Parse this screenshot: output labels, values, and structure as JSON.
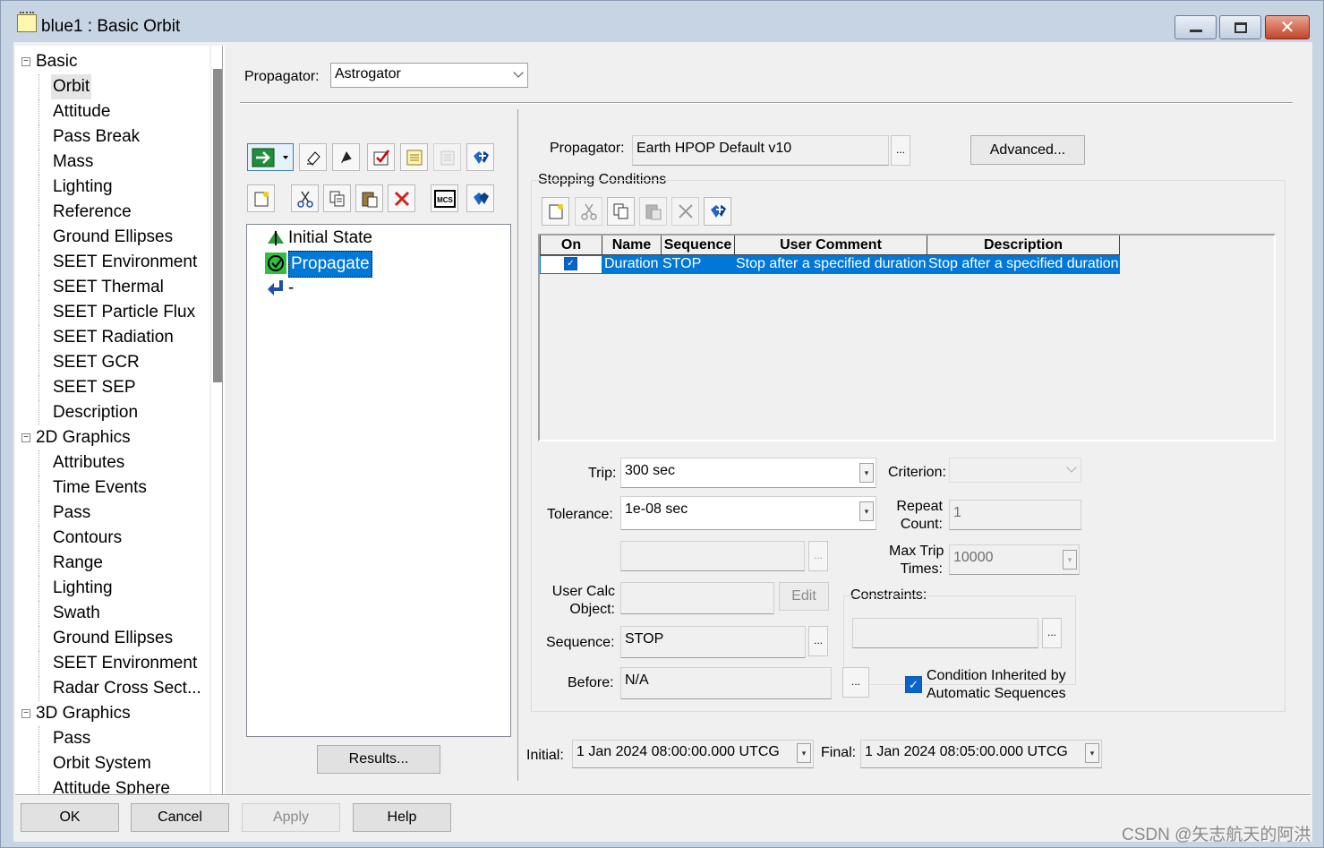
{
  "window": {
    "title": "blue1 : Basic Orbit",
    "min_icon": "minimize-icon",
    "max_icon": "maximize-icon",
    "close_icon": "close-icon"
  },
  "tree": {
    "nodes": [
      {
        "label": "Basic",
        "level": 0,
        "expander": "⊟"
      },
      {
        "label": "Orbit",
        "level": 1,
        "selected": true
      },
      {
        "label": "Attitude",
        "level": 1
      },
      {
        "label": "Pass Break",
        "level": 1
      },
      {
        "label": "Mass",
        "level": 1
      },
      {
        "label": "Lighting",
        "level": 1
      },
      {
        "label": "Reference",
        "level": 1
      },
      {
        "label": "Ground Ellipses",
        "level": 1
      },
      {
        "label": "SEET Environment",
        "level": 1
      },
      {
        "label": "SEET Thermal",
        "level": 1
      },
      {
        "label": "SEET Particle Flux",
        "level": 1
      },
      {
        "label": "SEET Radiation",
        "level": 1
      },
      {
        "label": "SEET GCR",
        "level": 1
      },
      {
        "label": "SEET SEP",
        "level": 1
      },
      {
        "label": "Description",
        "level": 1
      },
      {
        "label": "2D Graphics",
        "level": 0,
        "expander": "⊟"
      },
      {
        "label": "Attributes",
        "level": 1
      },
      {
        "label": "Time Events",
        "level": 1
      },
      {
        "label": "Pass",
        "level": 1
      },
      {
        "label": "Contours",
        "level": 1
      },
      {
        "label": "Range",
        "level": 1
      },
      {
        "label": "Lighting",
        "level": 1
      },
      {
        "label": "Swath",
        "level": 1
      },
      {
        "label": "Ground Ellipses",
        "level": 1
      },
      {
        "label": "SEET Environment",
        "level": 1
      },
      {
        "label": "Radar Cross Sect...",
        "level": 1
      },
      {
        "label": "3D Graphics",
        "level": 0,
        "expander": "⊟"
      },
      {
        "label": "Pass",
        "level": 1
      },
      {
        "label": "Orbit System",
        "level": 1
      },
      {
        "label": "Attitude Sphere",
        "level": 1
      }
    ]
  },
  "propagator_top": {
    "label": "Propagator:",
    "value": "Astrogator"
  },
  "mcs": {
    "items": [
      {
        "label": "Initial State",
        "icon": "initial-state-icon"
      },
      {
        "label": "Propagate",
        "icon": "propagate-icon",
        "selected": true
      },
      {
        "label": "-",
        "icon": "return-arrow-icon"
      }
    ],
    "results_button": "Results...",
    "toolbar_icons": [
      "run-icon",
      "dropdown-arrow-icon",
      "clear-icon",
      "target-icon",
      "checkbox-icon",
      "summary-icon",
      "notes-icon",
      "insert-segment-icon",
      "new-segment-icon",
      "cut-icon",
      "copy-icon",
      "paste-icon",
      "delete-icon",
      "mcs-icon",
      "options-icon"
    ],
    "mcs_text": "MCS"
  },
  "segment": {
    "propagator_label": "Propagator:",
    "propagator_value": "Earth HPOP Default v10",
    "ellipsis": "...",
    "advanced_button": "Advanced...",
    "stopping_conditions_label": "Stopping Conditions",
    "sc_toolbar_icons": [
      "new-icon",
      "cut-icon",
      "copy-icon",
      "paste-icon",
      "delete-icon",
      "insert-icon"
    ]
  },
  "grid": {
    "columns": [
      "On",
      "Name",
      "Sequence",
      "User Comment",
      "Description"
    ],
    "rows": [
      {
        "on": "✓",
        "name": "Duration",
        "sequence": "STOP",
        "comment": "Stop after a specified duration",
        "description": "Stop after a specified duration"
      }
    ]
  },
  "props": {
    "trip_label": "Trip:",
    "trip_value": "300 sec",
    "criterion_label": "Criterion:",
    "criterion_value": "",
    "tolerance_label": "Tolerance:",
    "tolerance_value": "1e-08 sec",
    "repeat_label_1": "Repeat",
    "repeat_label_2": "Count:",
    "repeat_value": "1",
    "maxtrip_label_1": "Max Trip",
    "maxtrip_label_2": "Times:",
    "maxtrip_value": "10000",
    "usercalc_label_1": "User Calc",
    "usercalc_label_2": "Object:",
    "usercalc_value": "",
    "edit_button": "Edit",
    "constraints_label": "Constraints:",
    "sequence_label": "Sequence:",
    "sequence_value": "STOP",
    "before_label": "Before:",
    "before_value": "N/A",
    "inherited_label_1": "Condition Inherited by",
    "inherited_label_2": "Automatic Sequences",
    "inherited_checked": "✓"
  },
  "times": {
    "initial_label": "Initial:",
    "initial_value": "1 Jan 2024 08:00:00.000 UTCG",
    "final_label": "Final:",
    "final_value": "1 Jan 2024 08:05:00.000 UTCG"
  },
  "footer": {
    "ok": "OK",
    "cancel": "Cancel",
    "apply": "Apply",
    "help": "Help"
  },
  "watermark": "CSDN @矢志航天的阿洪",
  "colors": {
    "selection": "#0078d7",
    "dialog_bg": "#f0f0f0",
    "frame": "#c7d4e4"
  }
}
